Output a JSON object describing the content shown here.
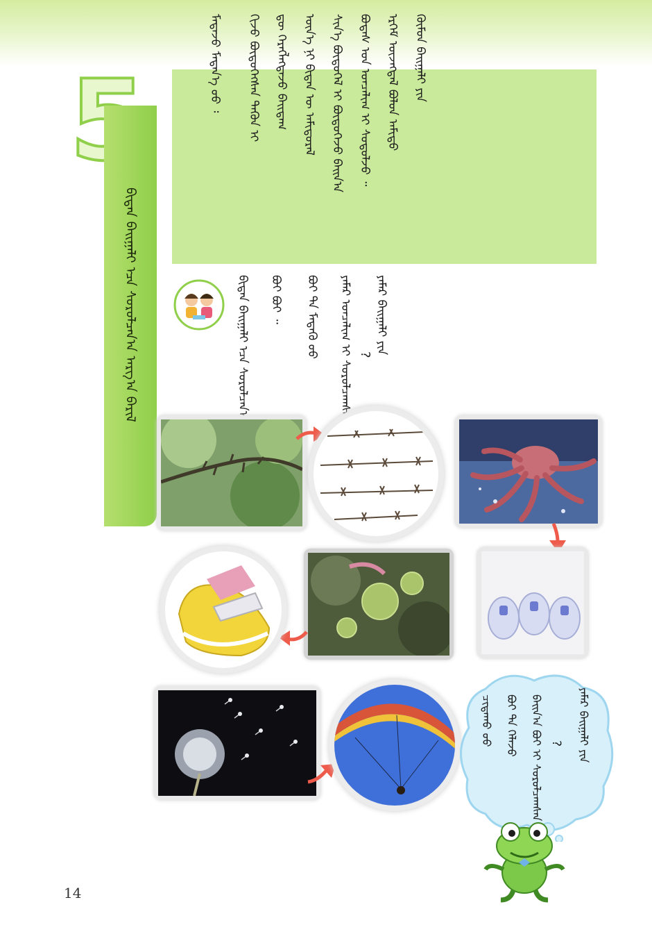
{
  "lesson": {
    "number": "5",
    "title": "ᠪᠢᠳᠡᠨ ᠪᠠᠢᠭᠠᠯᠢ ᠡᠴᠡ ᠰᠤᠷᠤᠯᠴᠠᠨ᠎ᠠ ᠠᠷᠭ᠎ᠠ ᠪᠠᠷᠢᠯ"
  },
  "text_box": {
    "lines": [
      "ᠬᠦᠮᠦᠨ ᠪᠠᠢᠭᠠᠯᠢ ᠶᠢᠨ",
      "ᠡᠷᠬᠡᠮ ᠦᠵᠡᠭᠳᠡᠯ ᠪᠤᠯᠤᠨ ᠠᠮᠢᠳᠤ",
      "ᠪᠤᠳᠠᠰ ᠤᠨ ᠣᠨᠴᠠᠯᠢᠭ ᠢ ᠰᠤᠳᠤᠯᠵᠤ ᠃",
      "ᠰᠢᠨ᠎ᠡ ᠪᠦᠲᠦᠭᠡᠯ ᠢ ᠪᠦᠲᠦᠭᠡᠵᠦ ᠪᠠᠢᠨ᠎ᠠ",
      "ᠦᠨ᠎ᠡ ᠨᠢ ᠪᠢᠳᠡᠨ ᠦ ᠠᠮᠢᠳᠤᠷᠠᠯ",
      "ᠳᠦ ᠬᠡᠷᠡᠭᠯᠡᠭᠳᠡᠵᠦ ᠪᠠᠢᠳᠠᠭ",
      "ᠬᠢᠵᠦ ᠪᠦᠲᠦᠭᠡᠭᠰᠡᠨ ᠲᠡᠭᠦᠨ ᠢ",
      "ᠮᠡᠳᠡᠵᠦ ᠮᠡᠳᠡᠨ᠎ᠡ ᠦᠦ ᠄"
    ]
  },
  "question": {
    "lines": [
      "ᠶᠠᠮᠠᠷ ᠪᠠᠢᠭᠠᠯᠢ ᠶᠢᠨ",
      "ᠶᠠᠮᠠᠷ ᠣᠨᠴᠠᠯᠢᠭ ᠢ ᠰᠤᠷᠤᠯᠴᠠᠭᠰᠠᠨ",
      "ᠪᠤᠢ ᠲᠠ ᠮᠡᠳᠡᠬᠦ ᠦᠦ",
      "ᠪᠤᠢ ᠪᠤᠢ ᠃"
    ],
    "end_mark": "?"
  },
  "cloud": {
    "lines": [
      "ᠶᠠᠮᠠᠷ ᠪᠠᠢᠭᠠᠯᠢ ᠶᠢᠨ",
      "ᠪᠠᠢᠨ᠎ᠠ ᠪᠤᠢ ᠢ ᠰᠤᠷᠤᠯᠴᠠᠭᠰᠠᠨ",
      "ᠪᠤᠢ ᠲᠠ ᠬᠡᠯᠡᠵᠦ",
      "ᠴᠢᠳᠠᠬᠤ ᠦᠦ"
    ],
    "end_mark": "?"
  },
  "photos": [
    {
      "name": "thorny-branch-photo"
    },
    {
      "name": "barbed-wire-photo"
    },
    {
      "name": "octopus-photo"
    },
    {
      "name": "suction-hooks-photo"
    },
    {
      "name": "burdock-burr-photo"
    },
    {
      "name": "velcro-shoe-photo"
    },
    {
      "name": "paraglider-photo"
    },
    {
      "name": "dandelion-photo"
    }
  ],
  "colors": {
    "accent_green": "#8fcf4a",
    "box_green": "#c9ea9b",
    "arrow_red": "#ef5b4b",
    "cloud_blue": "#bfe7f7"
  },
  "page_number": "14"
}
